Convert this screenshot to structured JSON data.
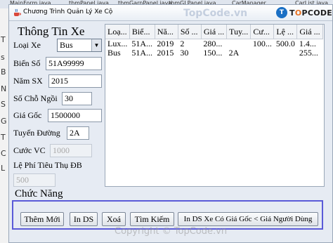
{
  "ide": {
    "tabs": [
      "MainForm.java",
      "tbmPanel.java",
      "tbmGarnPanel.java",
      "tbmGLPanel.java",
      "CarManager...",
      "CarList.java"
    ],
    "left_labels": [
      "T",
      "s",
      "B",
      "N",
      "S",
      "G",
      "T",
      "C",
      "L"
    ]
  },
  "window": {
    "title": "Chương Trình Quản Lý Xe Cộ",
    "logo": {
      "badge": "T",
      "text_pre": "T",
      "text_o": "O",
      "text_post": "PCODE.VN"
    },
    "watermark_top": "TopCode.vn",
    "watermark_bottom": "Copyright © TopCode.vn"
  },
  "form": {
    "title": "Thông Tin Xe",
    "loai_xe": {
      "label": "Loại Xe",
      "value": "Bus"
    },
    "bien_so": {
      "label": "Biển Số",
      "value": "51A99999"
    },
    "nam_sx": {
      "label": "Năm SX",
      "value": "2015"
    },
    "so_cho": {
      "label": "Số Chỗ Ngồi",
      "value": "30"
    },
    "gia_goc": {
      "label": "Giá Gốc",
      "value": "1500000"
    },
    "tuyen": {
      "label": "Tuyến Đường",
      "value": "2A"
    },
    "cuoc_vc": {
      "label": "Cước VC",
      "value": "1000"
    },
    "le_phi": {
      "label": "Lệ Phí Tiêu Thụ ĐB",
      "value": "500"
    }
  },
  "table": {
    "columns": [
      "Loạ...",
      "Biể...",
      "Nă...",
      "Số ...",
      "Giá ...",
      "Tuy...",
      "Cư...",
      "Lệ ...",
      "Giá ..."
    ],
    "rows": [
      [
        "Lux...",
        "51A...",
        "2019",
        "2",
        "280...",
        "",
        "100...",
        "500.0",
        "1.4..."
      ],
      [
        "Bus",
        "51A...",
        "2015",
        "30",
        "150...",
        "2A",
        "",
        "",
        "255..."
      ]
    ]
  },
  "functions": {
    "title": "Chức Năng",
    "buttons": {
      "add": "Thêm Mới",
      "print": "In DS",
      "delete": "Xoá",
      "search": "Tìm Kiếm",
      "filter": "In DS Xe Có Giá Gốc < Giá Người Dùng"
    }
  },
  "colors": {
    "accent": "#5a5ad8",
    "brand": "#1a6fc4",
    "brand_orange": "#e8701f"
  }
}
